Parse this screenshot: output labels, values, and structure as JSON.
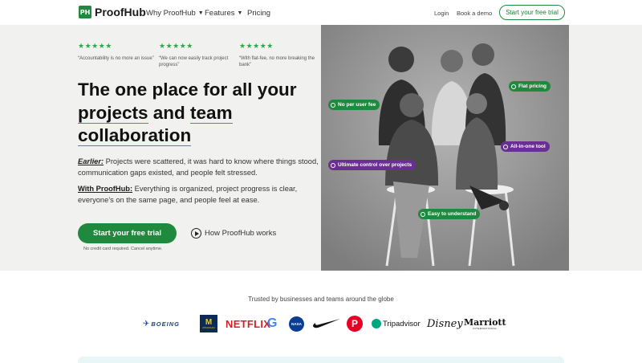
{
  "nav": {
    "brand": "ProofHub",
    "logo_mark": "PH",
    "links": [
      "Why ProofHub",
      "Features",
      "Pricing"
    ],
    "login": "Login",
    "demo": "Book a demo",
    "cta": "Start your free trial"
  },
  "hero": {
    "reviews": [
      {
        "stars": "★★★★★",
        "text": "“Accountability is no more an issue”"
      },
      {
        "stars": "★★★★★",
        "text": "“We can now easily track project progress”"
      },
      {
        "stars": "★★★★★",
        "text": "“With flat-fee, no more breaking the bank”"
      }
    ],
    "headline_1": "The one place for all your",
    "headline_2a": "projects",
    "headline_2b": " and ",
    "headline_2c": "team",
    "headline_3": "collaboration",
    "earlier_lead": "Earlier:",
    "earlier_text": " Projects were scattered, it was hard to know where things stood, communication gaps existed, and people felt stressed.",
    "with_lead": "With ProofHub:",
    "with_text": " Everything is organized, project progress is clear, everyone’s on the same page, and people feel at ease.",
    "cta": "Start your free trial",
    "cta_note": "No credit card required. Cancel anytime.",
    "how": "How ProofHub works"
  },
  "photo_tags": {
    "flat_pricing": "Flat pricing",
    "no_per_user": "No per user fee",
    "all_in_one": "All-in-one tool",
    "ultimate_control": "Ultimate control over projects",
    "easy": "Easy to understand"
  },
  "trust": {
    "title": "Trusted by businesses and teams around the globe",
    "brands": [
      "BOEING",
      "M",
      "MICHIGAN",
      "NETFLIX",
      "G",
      "NASA",
      "nike-swoosh",
      "P",
      "Tripadvisor",
      "Disney",
      "Marriott",
      "INTERNATIONAL"
    ]
  },
  "colors": {
    "brand_green": "#1f8a3d",
    "tag_purple": "#6a2f93",
    "hero_bg": "#f1f2f0"
  }
}
